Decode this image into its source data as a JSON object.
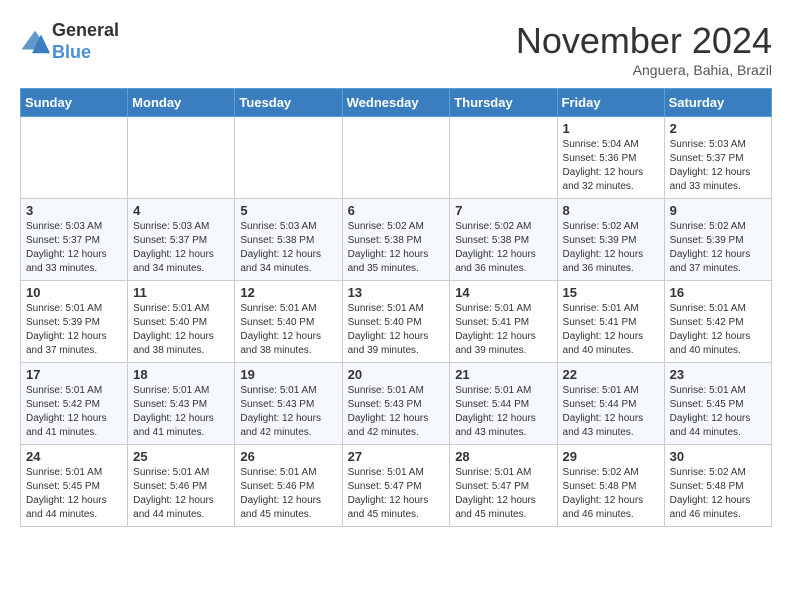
{
  "header": {
    "logo_line1": "General",
    "logo_line2": "Blue",
    "month": "November 2024",
    "location": "Anguera, Bahia, Brazil"
  },
  "weekdays": [
    "Sunday",
    "Monday",
    "Tuesday",
    "Wednesday",
    "Thursday",
    "Friday",
    "Saturday"
  ],
  "weeks": [
    [
      {
        "day": "",
        "info": ""
      },
      {
        "day": "",
        "info": ""
      },
      {
        "day": "",
        "info": ""
      },
      {
        "day": "",
        "info": ""
      },
      {
        "day": "",
        "info": ""
      },
      {
        "day": "1",
        "info": "Sunrise: 5:04 AM\nSunset: 5:36 PM\nDaylight: 12 hours\nand 32 minutes."
      },
      {
        "day": "2",
        "info": "Sunrise: 5:03 AM\nSunset: 5:37 PM\nDaylight: 12 hours\nand 33 minutes."
      }
    ],
    [
      {
        "day": "3",
        "info": "Sunrise: 5:03 AM\nSunset: 5:37 PM\nDaylight: 12 hours\nand 33 minutes."
      },
      {
        "day": "4",
        "info": "Sunrise: 5:03 AM\nSunset: 5:37 PM\nDaylight: 12 hours\nand 34 minutes."
      },
      {
        "day": "5",
        "info": "Sunrise: 5:03 AM\nSunset: 5:38 PM\nDaylight: 12 hours\nand 34 minutes."
      },
      {
        "day": "6",
        "info": "Sunrise: 5:02 AM\nSunset: 5:38 PM\nDaylight: 12 hours\nand 35 minutes."
      },
      {
        "day": "7",
        "info": "Sunrise: 5:02 AM\nSunset: 5:38 PM\nDaylight: 12 hours\nand 36 minutes."
      },
      {
        "day": "8",
        "info": "Sunrise: 5:02 AM\nSunset: 5:39 PM\nDaylight: 12 hours\nand 36 minutes."
      },
      {
        "day": "9",
        "info": "Sunrise: 5:02 AM\nSunset: 5:39 PM\nDaylight: 12 hours\nand 37 minutes."
      }
    ],
    [
      {
        "day": "10",
        "info": "Sunrise: 5:01 AM\nSunset: 5:39 PM\nDaylight: 12 hours\nand 37 minutes."
      },
      {
        "day": "11",
        "info": "Sunrise: 5:01 AM\nSunset: 5:40 PM\nDaylight: 12 hours\nand 38 minutes."
      },
      {
        "day": "12",
        "info": "Sunrise: 5:01 AM\nSunset: 5:40 PM\nDaylight: 12 hours\nand 38 minutes."
      },
      {
        "day": "13",
        "info": "Sunrise: 5:01 AM\nSunset: 5:40 PM\nDaylight: 12 hours\nand 39 minutes."
      },
      {
        "day": "14",
        "info": "Sunrise: 5:01 AM\nSunset: 5:41 PM\nDaylight: 12 hours\nand 39 minutes."
      },
      {
        "day": "15",
        "info": "Sunrise: 5:01 AM\nSunset: 5:41 PM\nDaylight: 12 hours\nand 40 minutes."
      },
      {
        "day": "16",
        "info": "Sunrise: 5:01 AM\nSunset: 5:42 PM\nDaylight: 12 hours\nand 40 minutes."
      }
    ],
    [
      {
        "day": "17",
        "info": "Sunrise: 5:01 AM\nSunset: 5:42 PM\nDaylight: 12 hours\nand 41 minutes."
      },
      {
        "day": "18",
        "info": "Sunrise: 5:01 AM\nSunset: 5:43 PM\nDaylight: 12 hours\nand 41 minutes."
      },
      {
        "day": "19",
        "info": "Sunrise: 5:01 AM\nSunset: 5:43 PM\nDaylight: 12 hours\nand 42 minutes."
      },
      {
        "day": "20",
        "info": "Sunrise: 5:01 AM\nSunset: 5:43 PM\nDaylight: 12 hours\nand 42 minutes."
      },
      {
        "day": "21",
        "info": "Sunrise: 5:01 AM\nSunset: 5:44 PM\nDaylight: 12 hours\nand 43 minutes."
      },
      {
        "day": "22",
        "info": "Sunrise: 5:01 AM\nSunset: 5:44 PM\nDaylight: 12 hours\nand 43 minutes."
      },
      {
        "day": "23",
        "info": "Sunrise: 5:01 AM\nSunset: 5:45 PM\nDaylight: 12 hours\nand 44 minutes."
      }
    ],
    [
      {
        "day": "24",
        "info": "Sunrise: 5:01 AM\nSunset: 5:45 PM\nDaylight: 12 hours\nand 44 minutes."
      },
      {
        "day": "25",
        "info": "Sunrise: 5:01 AM\nSunset: 5:46 PM\nDaylight: 12 hours\nand 44 minutes."
      },
      {
        "day": "26",
        "info": "Sunrise: 5:01 AM\nSunset: 5:46 PM\nDaylight: 12 hours\nand 45 minutes."
      },
      {
        "day": "27",
        "info": "Sunrise: 5:01 AM\nSunset: 5:47 PM\nDaylight: 12 hours\nand 45 minutes."
      },
      {
        "day": "28",
        "info": "Sunrise: 5:01 AM\nSunset: 5:47 PM\nDaylight: 12 hours\nand 45 minutes."
      },
      {
        "day": "29",
        "info": "Sunrise: 5:02 AM\nSunset: 5:48 PM\nDaylight: 12 hours\nand 46 minutes."
      },
      {
        "day": "30",
        "info": "Sunrise: 5:02 AM\nSunset: 5:48 PM\nDaylight: 12 hours\nand 46 minutes."
      }
    ]
  ]
}
